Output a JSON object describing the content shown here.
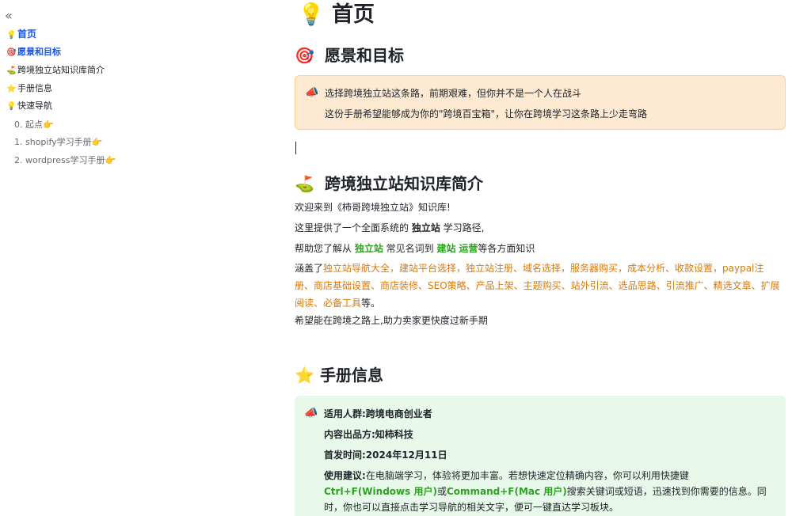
{
  "sidebar": {
    "collapse_icon": "«",
    "items": [
      {
        "emoji": "💡",
        "label": "首页"
      },
      {
        "emoji": "🎯",
        "label": "愿景和目标"
      },
      {
        "emoji": "⛳",
        "label": "跨境独立站知识库简介"
      },
      {
        "emoji": "⭐",
        "label": "手册信息"
      },
      {
        "emoji": "💡",
        "label": "快速导航"
      }
    ],
    "sub_items": [
      {
        "label": "0. 起点",
        "emoji": "👉"
      },
      {
        "label": "1. shopify学习手册",
        "emoji": "👉"
      },
      {
        "label": "2. wordpress学习手册",
        "emoji": "👉"
      }
    ]
  },
  "main": {
    "title_emoji": "💡",
    "title": "首页",
    "vision": {
      "emoji": "🎯",
      "heading": "愿景和目标",
      "callout_emoji": "📣",
      "line1": "选择跨境独立站这条路，前期艰难，但你并不是一个人在战斗",
      "line2": "这份手册希望能够成为你的\"跨境百宝箱\"，让你在跨境学习这条路上少走弯路"
    },
    "intro": {
      "emoji": "⛳",
      "heading": "跨境独立站知识库简介",
      "p1": "欢迎来到《柿哥跨境独立站》知识库!",
      "p2_pre": "这里提供了一个全面系统的 ",
      "p2_bold": "独立站",
      "p2_post": " 学习路径,",
      "p3_pre": "帮助您了解从 ",
      "p3_g1": "独立站",
      "p3_mid": " 常见名词到 ",
      "p3_g2": "建站",
      "p3_sp": " ",
      "p3_g3": "运营",
      "p3_post": "等各方面知识",
      "p4_pre": "涵盖了",
      "p4_topics": "独立站导航大全，建站平台选择，独立站注册、域名选择，服务器购买，成本分析、收款设置，paypal注册、商店基础设置、商店装修、SEO策略、产品上架、主题购买、站外引流、选品思路、引流推广、精选文章、扩展阅读、必备工具",
      "p4_post": "等。",
      "p5": "希望能在跨境之路上,助力卖家更快度过新手期"
    },
    "info": {
      "emoji": "⭐",
      "heading": "手册信息",
      "callout_emoji": "📣",
      "audience": "适用人群:跨境电商创业者",
      "producer": "内容出品方:知柿科技",
      "date": "首发时间:2024年12月11日",
      "tip_label": "使用建议:",
      "tip_text": "在电脑端学习，体验将更加丰富。若想快速定位精确内容，你可以利用快捷键",
      "shortcut_win": "Ctrl+F(Windows 用户)",
      "or": "或",
      "shortcut_mac": "Command+F(Mac 用户)",
      "tip_text2": "搜索关键词或短语，迅速找到你需要的信息。同",
      "tip_text3": "时，你也可以直接点击学习导航的相关文字，便可一键直达学习板块。"
    }
  }
}
